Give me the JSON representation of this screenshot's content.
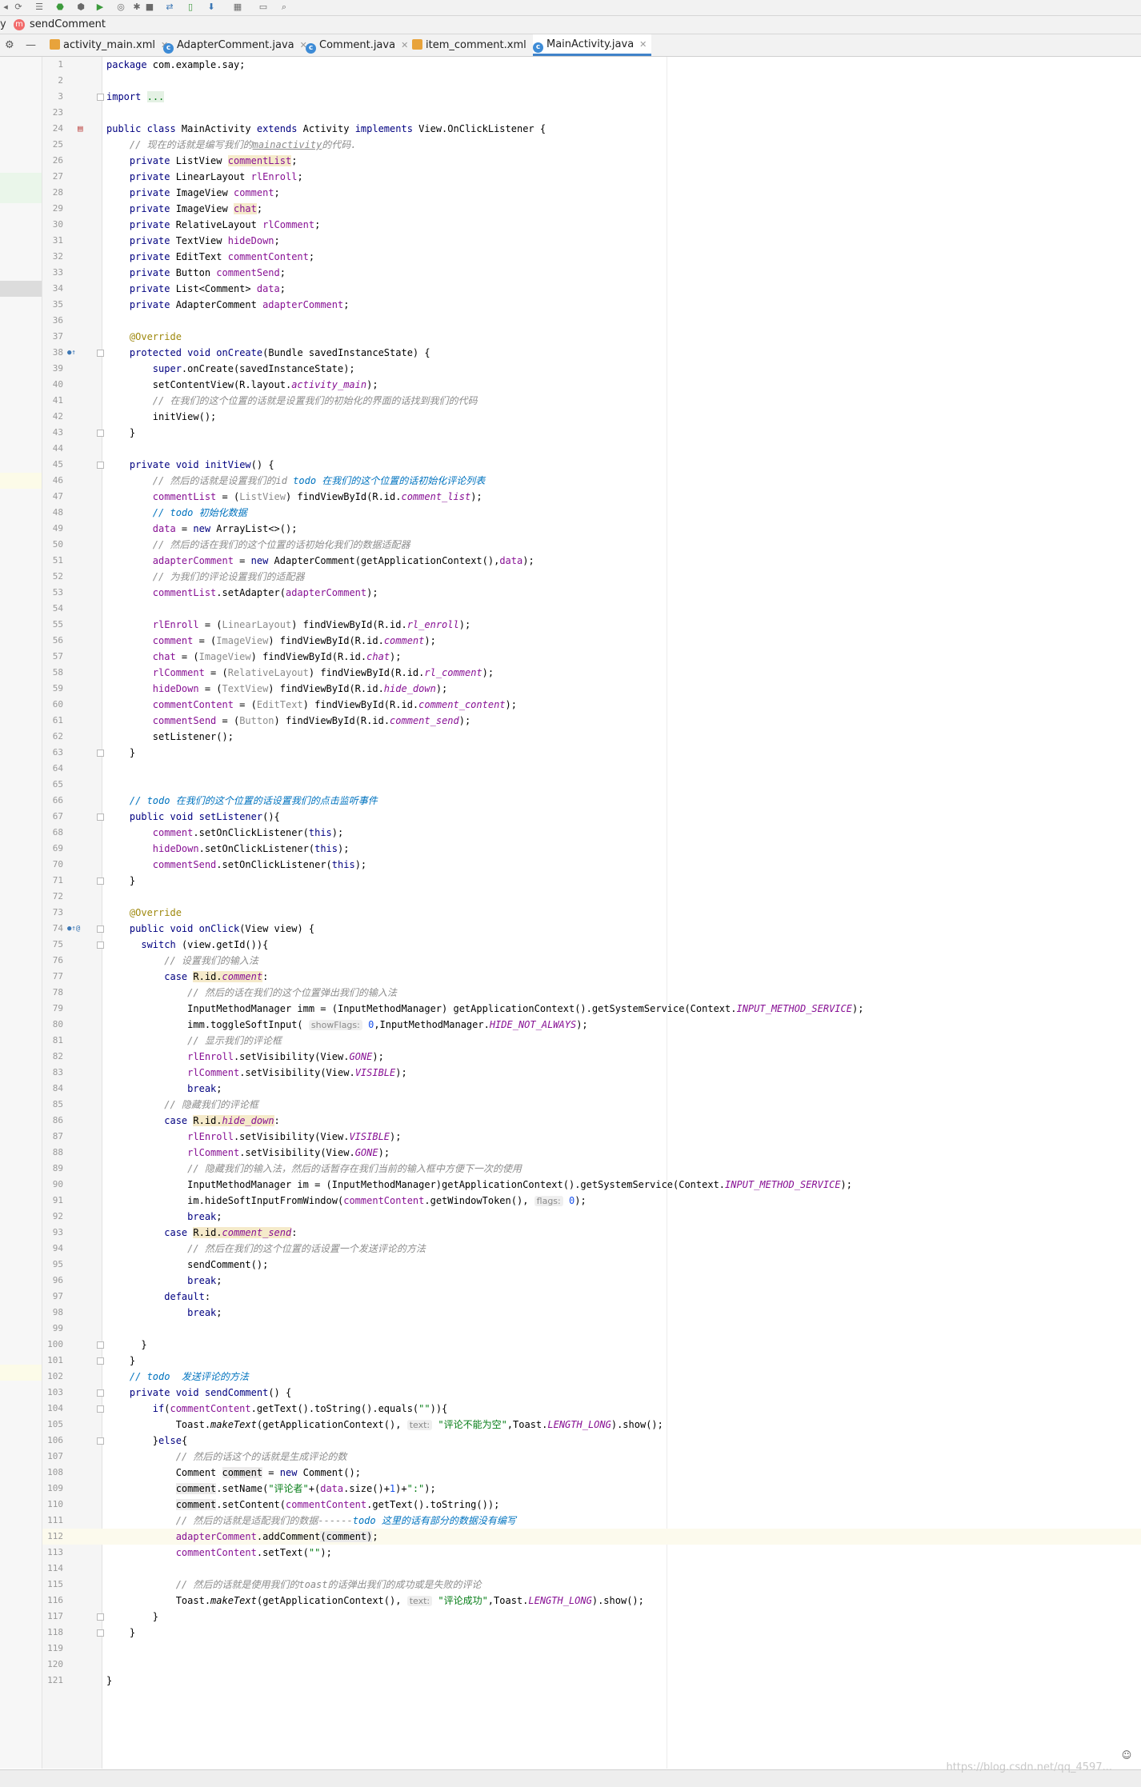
{
  "navbar": {
    "prefix": "y",
    "method_badge": "m",
    "method_label": "sendComment"
  },
  "tabs": [
    {
      "label": "activity_main.xml",
      "type": "xml"
    },
    {
      "label": "AdapterComment.java",
      "type": "java"
    },
    {
      "label": "Comment.java",
      "type": "java"
    },
    {
      "label": "item_comment.xml",
      "type": "xml"
    },
    {
      "label": "MainActivity.java",
      "type": "java",
      "active": true
    }
  ],
  "editor": {
    "file": "MainActivity.java",
    "caret_line": 112
  },
  "code_lines": [
    {
      "n": "1",
      "html": "<span class=\"kw\">package</span> com.example.say;"
    },
    {
      "n": "2",
      "html": ""
    },
    {
      "n": "3",
      "html": "<span class=\"kw\">import</span> <span class=\"fold-txt\">...</span>",
      "fold": true
    },
    {
      "n": "23",
      "html": ""
    },
    {
      "n": "24",
      "html": "<span class=\"kw\">public class</span> MainActivity <span class=\"kw\">extends</span> Activity <span class=\"kw\">implements</span> View.OnClickListener {",
      "icon": "activity"
    },
    {
      "n": "25",
      "html": "    <span class=\"cm\">// 现在的话就是编写我们的<u>mainactivity</u>的代码.</span>"
    },
    {
      "n": "26",
      "html": "    <span class=\"kw\">private</span> ListView <span class=\"fld hl\">commentList</span>;"
    },
    {
      "n": "27",
      "html": "    <span class=\"kw\">private</span> LinearLayout <span class=\"fld\">rlEnroll</span>;"
    },
    {
      "n": "28",
      "html": "    <span class=\"kw\">private</span> ImageView <span class=\"fld\">comment</span>;"
    },
    {
      "n": "29",
      "html": "    <span class=\"kw\">private</span> ImageView <span class=\"fld hl\">chat</span>;"
    },
    {
      "n": "30",
      "html": "    <span class=\"kw\">private</span> RelativeLayout <span class=\"fld\">rlComment</span>;"
    },
    {
      "n": "31",
      "html": "    <span class=\"kw\">private</span> TextView <span class=\"fld\">hideDown</span>;"
    },
    {
      "n": "32",
      "html": "    <span class=\"kw\">private</span> EditText <span class=\"fld\">commentContent</span>;"
    },
    {
      "n": "33",
      "html": "    <span class=\"kw\">private</span> Button <span class=\"fld\">commentSend</span>;"
    },
    {
      "n": "34",
      "html": "    <span class=\"kw\">private</span> List&lt;Comment&gt; <span class=\"fld\">data</span>;"
    },
    {
      "n": "35",
      "html": "    <span class=\"kw\">private</span> AdapterComment <span class=\"fld\">adapterComment</span>;"
    },
    {
      "n": "36",
      "html": ""
    },
    {
      "n": "37",
      "html": "    <span class=\"ann\">@Override</span>"
    },
    {
      "n": "38",
      "html": "    <span class=\"kw\">protected void</span> <span class=\"kw\">onCreate</span>(Bundle savedInstanceState) {",
      "icon": "override",
      "fold": true
    },
    {
      "n": "39",
      "html": "        <span class=\"kw\">super</span>.onCreate(savedInstanceState);"
    },
    {
      "n": "40",
      "html": "        setContentView(R.layout.<span class=\"cst\">activity_main</span>);"
    },
    {
      "n": "41",
      "html": "        <span class=\"cm\">// 在我们的这个位置的话就是设置我们的初始化的界面的话找到我们的代码</span>"
    },
    {
      "n": "42",
      "html": "        initView();"
    },
    {
      "n": "43",
      "html": "    }",
      "fold": true
    },
    {
      "n": "44",
      "html": ""
    },
    {
      "n": "45",
      "html": "    <span class=\"kw\">private void</span> <span class=\"kw\">initView</span>() {",
      "fold": true
    },
    {
      "n": "46",
      "html": "        <span class=\"cm\">// 然后的话就是设置我们的id </span><span class=\"todo\">todo 在我们的这个位置的话初始化评论列表</span>"
    },
    {
      "n": "47",
      "html": "        <span class=\"fld\">commentList</span> = (<span class=\"cm\" style=\"font-style:normal\">ListView</span>) findViewById(R.id.<span class=\"cst\">comment_list</span>);"
    },
    {
      "n": "48",
      "html": "        <span class=\"todo\">// todo 初始化数据</span>"
    },
    {
      "n": "49",
      "html": "        <span class=\"fld\">data</span> = <span class=\"kw\">new</span> ArrayList&lt;&gt;();"
    },
    {
      "n": "50",
      "html": "        <span class=\"cm\">// 然后的话在我们的这个位置的话初始化我们的数据适配器</span>"
    },
    {
      "n": "51",
      "html": "        <span class=\"fld\">adapterComment</span> = <span class=\"kw\">new</span> AdapterComment(getApplicationContext(),<span class=\"fld\">data</span>);"
    },
    {
      "n": "52",
      "html": "        <span class=\"cm\">// 为我们的评论设置我们的适配器</span>"
    },
    {
      "n": "53",
      "html": "        <span class=\"fld\">commentList</span>.setAdapter(<span class=\"fld\">adapterComment</span>);"
    },
    {
      "n": "54",
      "html": ""
    },
    {
      "n": "55",
      "html": "        <span class=\"fld\">rlEnroll</span> = (<span class=\"cm\" style=\"font-style:normal\">LinearLayout</span>) findViewById(R.id.<span class=\"cst\">rl_enroll</span>);"
    },
    {
      "n": "56",
      "html": "        <span class=\"fld\">comment</span> = (<span class=\"cm\" style=\"font-style:normal\">ImageView</span>) findViewById(R.id.<span class=\"cst\">comment</span>);"
    },
    {
      "n": "57",
      "html": "        <span class=\"fld\">chat</span> = (<span class=\"cm\" style=\"font-style:normal\">ImageView</span>) findViewById(R.id.<span class=\"cst\">chat</span>);"
    },
    {
      "n": "58",
      "html": "        <span class=\"fld\">rlComment</span> = (<span class=\"cm\" style=\"font-style:normal\">RelativeLayout</span>) findViewById(R.id.<span class=\"cst\">rl_comment</span>);"
    },
    {
      "n": "59",
      "html": "        <span class=\"fld\">hideDown</span> = (<span class=\"cm\" style=\"font-style:normal\">TextView</span>) findViewById(R.id.<span class=\"cst\">hide_down</span>);"
    },
    {
      "n": "60",
      "html": "        <span class=\"fld\">commentContent</span> = (<span class=\"cm\" style=\"font-style:normal\">EditText</span>) findViewById(R.id.<span class=\"cst\">comment_content</span>);"
    },
    {
      "n": "61",
      "html": "        <span class=\"fld\">commentSend</span> = (<span class=\"cm\" style=\"font-style:normal\">Button</span>) findViewById(R.id.<span class=\"cst\">comment_send</span>);"
    },
    {
      "n": "62",
      "html": "        setListener();"
    },
    {
      "n": "63",
      "html": "    }",
      "fold": true
    },
    {
      "n": "64",
      "html": ""
    },
    {
      "n": "65",
      "html": ""
    },
    {
      "n": "66",
      "html": "    <span class=\"todo\">// todo 在我们的这个位置的话设置我们的点击监听事件</span>"
    },
    {
      "n": "67",
      "html": "    <span class=\"kw\">public void</span> <span class=\"kw\">setListener</span>(){",
      "fold": true
    },
    {
      "n": "68",
      "html": "        <span class=\"fld\">comment</span>.setOnClickListener(<span class=\"kw\">this</span>);"
    },
    {
      "n": "69",
      "html": "        <span class=\"fld\">hideDown</span>.setOnClickListener(<span class=\"kw\">this</span>);"
    },
    {
      "n": "70",
      "html": "        <span class=\"fld\">commentSend</span>.setOnClickListener(<span class=\"kw\">this</span>);"
    },
    {
      "n": "71",
      "html": "    }",
      "fold": true
    },
    {
      "n": "72",
      "html": ""
    },
    {
      "n": "73",
      "html": "    <span class=\"ann\">@Override</span>"
    },
    {
      "n": "74",
      "html": "    <span class=\"kw\">public void</span> <span class=\"kw\">onClick</span>(View view) {",
      "icon": "override-at",
      "fold": true
    },
    {
      "n": "75",
      "html": "      <span class=\"kw\">switch</span> (view.getId()){",
      "fold": true
    },
    {
      "n": "76",
      "html": "          <span class=\"cm\">// 设置我们的输入法</span>"
    },
    {
      "n": "77",
      "html": "          <span class=\"kw\">case</span> <span class=\"hl\">R.id.<span class=\"cst\">comment</span></span>:"
    },
    {
      "n": "78",
      "html": "              <span class=\"cm\">// 然后的话在我们的这个位置弹出我们的输入法</span>"
    },
    {
      "n": "79",
      "html": "              InputMethodManager imm = (InputMethodManager) getApplicationContext().getSystemService(Context.<span class=\"cst\">INPUT_METHOD_SERVICE</span>);"
    },
    {
      "n": "80",
      "html": "              imm.toggleSoftInput( <span class=\"hint\">showFlags:</span> <span class=\"num\">0</span>,InputMethodManager.<span class=\"cst\">HIDE_NOT_ALWAYS</span>);"
    },
    {
      "n": "81",
      "html": "              <span class=\"cm\">// 显示我们的评论框</span>"
    },
    {
      "n": "82",
      "html": "              <span class=\"fld\">rlEnroll</span>.setVisibility(View.<span class=\"cst\">GONE</span>);"
    },
    {
      "n": "83",
      "html": "              <span class=\"fld\">rlComment</span>.setVisibility(View.<span class=\"cst\">VISIBLE</span>);"
    },
    {
      "n": "84",
      "html": "              <span class=\"kw\">break</span>;"
    },
    {
      "n": "85",
      "html": "          <span class=\"cm\">// 隐藏我们的评论框</span>"
    },
    {
      "n": "86",
      "html": "          <span class=\"kw\">case</span> <span class=\"hl\">R.id.<span class=\"cst\">hide_down</span></span>:"
    },
    {
      "n": "87",
      "html": "              <span class=\"fld\">rlEnroll</span>.setVisibility(View.<span class=\"cst\">VISIBLE</span>);"
    },
    {
      "n": "88",
      "html": "              <span class=\"fld\">rlComment</span>.setVisibility(View.<span class=\"cst\">GONE</span>);"
    },
    {
      "n": "89",
      "html": "              <span class=\"cm\">// 隐藏我们的输入法，然后的话暂存在我们当前的输入框中方便下一次的使用</span>"
    },
    {
      "n": "90",
      "html": "              InputMethodManager im = (InputMethodManager)getApplicationContext().getSystemService(Context.<span class=\"cst\">INPUT_METHOD_SERVICE</span>);"
    },
    {
      "n": "91",
      "html": "              im.hideSoftInputFromWindow(<span class=\"fld\">commentContent</span>.getWindowToken(), <span class=\"hint\">flags:</span> <span class=\"num\">0</span>);"
    },
    {
      "n": "92",
      "html": "              <span class=\"kw\">break</span>;"
    },
    {
      "n": "93",
      "html": "          <span class=\"kw\">case</span> <span class=\"hl\">R.id.<span class=\"cst\">comment_send</span></span>:"
    },
    {
      "n": "94",
      "html": "              <span class=\"cm\">// 然后在我们的这个位置的话设置一个发送评论的方法</span>"
    },
    {
      "n": "95",
      "html": "              sendComment();"
    },
    {
      "n": "96",
      "html": "              <span class=\"kw\">break</span>;"
    },
    {
      "n": "97",
      "html": "          <span class=\"kw\">default</span>:"
    },
    {
      "n": "98",
      "html": "              <span class=\"kw\">break</span>;"
    },
    {
      "n": "99",
      "html": ""
    },
    {
      "n": "100",
      "html": "      }",
      "fold": true
    },
    {
      "n": "101",
      "html": "    }",
      "fold": true
    },
    {
      "n": "102",
      "html": "    <span class=\"todo\">// todo  发送评论的方法</span>"
    },
    {
      "n": "103",
      "html": "    <span class=\"kw\">private void</span> <span class=\"kw\">sendComment</span>() {",
      "fold": true
    },
    {
      "n": "104",
      "html": "        <span class=\"kw\">if</span>(<span class=\"fld\">commentContent</span>.getText().toString().equals(<span class=\"str\">\"\"</span>)){",
      "fold": true
    },
    {
      "n": "105",
      "html": "            Toast.<span class=\"static\">makeText</span>(getApplicationContext(), <span class=\"hint\">text:</span> <span class=\"str\">\"评论不能为空\"</span>,Toast.<span class=\"cst\">LENGTH_LONG</span>).show();"
    },
    {
      "n": "106",
      "html": "        }<span class=\"kw\">else</span>{",
      "fold": true
    },
    {
      "n": "107",
      "html": "            <span class=\"cm\">// 然后的话这个的话就是生成评论的数</span>"
    },
    {
      "n": "108",
      "html": "            Comment <span class=\"hl2\">comment</span> = <span class=\"kw\">new</span> Comment();"
    },
    {
      "n": "109",
      "html": "            <span class=\"hl2\">comment</span>.setName(<span class=\"str\">\"评论者\"</span>+(<span class=\"fld\">data</span>.size()+<span class=\"num\">1</span>)+<span class=\"str\">\":\"</span>);"
    },
    {
      "n": "110",
      "html": "            <span class=\"hl2\">comment</span>.setContent(<span class=\"fld\">commentContent</span>.getText().toString());"
    },
    {
      "n": "111",
      "html": "            <span class=\"cm\">// 然后的话就是适配我们的数据------</span><span class=\"todo\">todo 这里的话有部分的数据没有编写</span>"
    },
    {
      "n": "112",
      "html": "            <span class=\"fld\">adapterComment</span>.addComment<span class=\"hl2\">(</span><span class=\"hl2\">comment</span><span class=\"hl2\">)</span>;"
    },
    {
      "n": "113",
      "html": "            <span class=\"fld\">commentContent</span>.setText(<span class=\"str\">\"\"</span>);"
    },
    {
      "n": "114",
      "html": ""
    },
    {
      "n": "115",
      "html": "            <span class=\"cm\">// 然后的话就是使用我们的toast的话弹出我们的成功或是失败的评论</span>"
    },
    {
      "n": "116",
      "html": "            Toast.<span class=\"static\">makeText</span>(getApplicationContext(), <span class=\"hint\">text:</span> <span class=\"str\">\"评论成功\"</span>,Toast.<span class=\"cst\">LENGTH_LONG</span>).show();"
    },
    {
      "n": "117",
      "html": "        }",
      "fold": true
    },
    {
      "n": "118",
      "html": "    }",
      "fold": true
    },
    {
      "n": "119",
      "html": ""
    },
    {
      "n": "120",
      "html": ""
    },
    {
      "n": "121",
      "html": "}"
    }
  ],
  "status": {
    "watermark": "https://blog.csdn.net/qq_4597..."
  }
}
